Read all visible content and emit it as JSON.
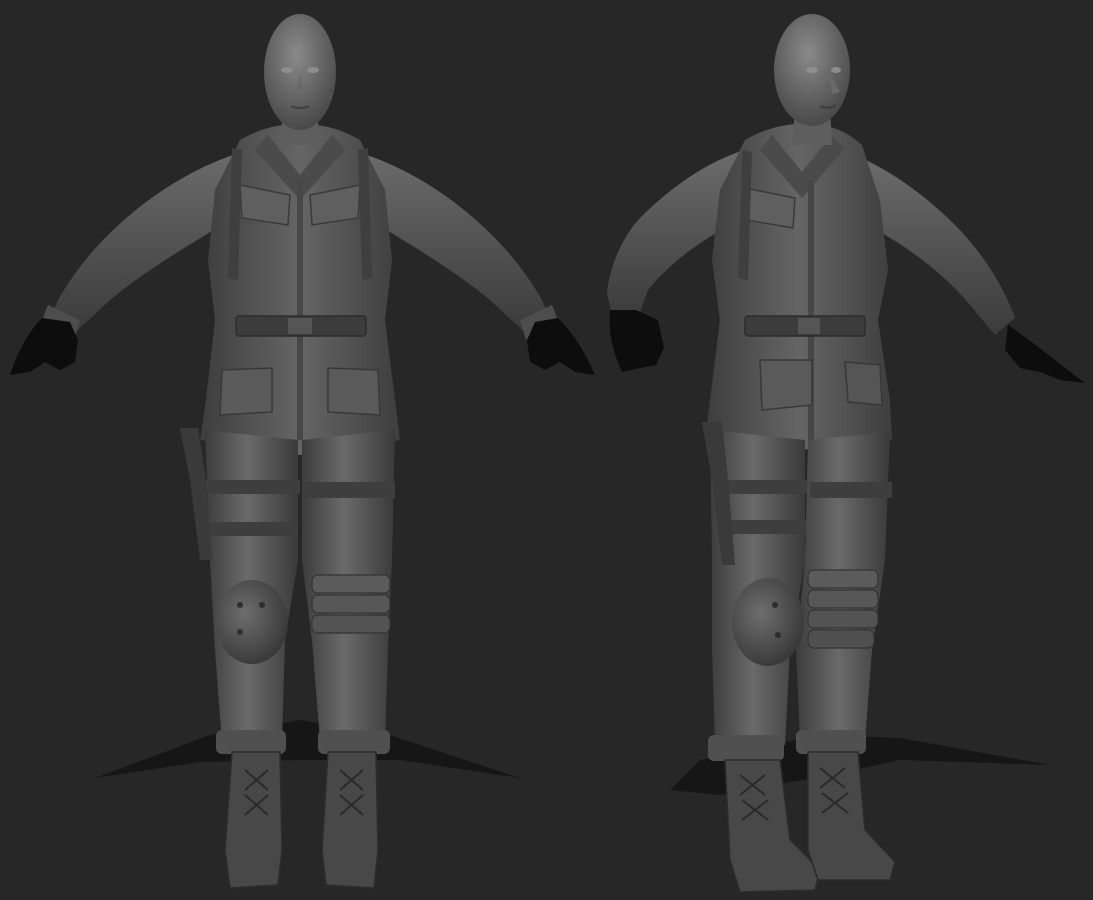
{
  "scene": {
    "background_color": "#272727",
    "subject": "sculpt-render",
    "views": [
      {
        "id": "front",
        "name": "front-view"
      },
      {
        "id": "three-quarter",
        "name": "three-quarter-view"
      }
    ]
  },
  "palette": {
    "clay_base": "#5a5a5a",
    "clay_mid": "#4a4a4a",
    "clay_dark": "#3a3a3a",
    "clay_light": "#777777",
    "clay_highlight": "#8c8c8c",
    "gloves": "#0d0d0d",
    "shadow": "#0f0f0f"
  }
}
